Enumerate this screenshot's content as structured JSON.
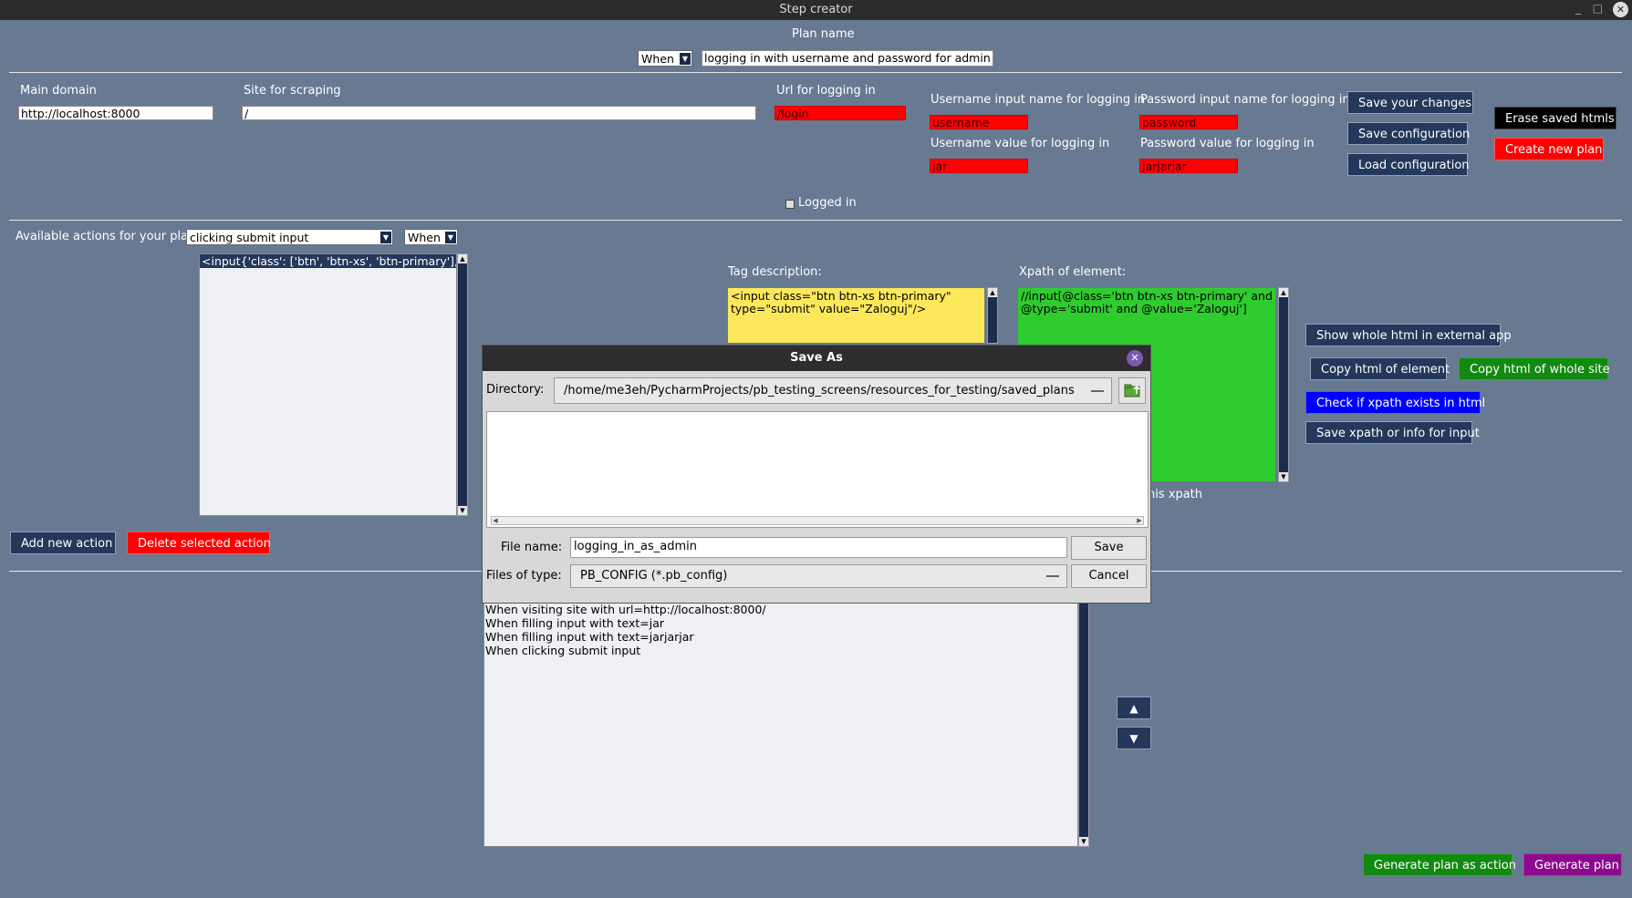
{
  "window": {
    "title": "Step creator",
    "minimize": "_",
    "maximize": "□",
    "close": "✕"
  },
  "plan": {
    "label": "Plan name",
    "when": "When",
    "name_value": "logging in with username and password for admin"
  },
  "config": {
    "main_domain_label": "Main domain",
    "main_domain_value": "http://localhost:8000",
    "site_label": "Site for scraping",
    "site_value": "/",
    "url_login_label": "Url for logging in",
    "url_login_value": "/login",
    "username_input_label": "Username input name for logging in",
    "username_input_value": "username",
    "username_value_label": "Username value for logging in",
    "username_value_value": "jar",
    "password_input_label": "Password input name for logging in",
    "password_input_value": "password",
    "password_value_label": "Password value for logging in",
    "password_value_value": "jarjarjar",
    "logged_in_label": "Logged in",
    "save_changes": "Save your changes",
    "save_config": "Save configuration",
    "load_config": "Load configuration",
    "erase_htmls": "Erase saved htmls",
    "create_plan": "Create new plan"
  },
  "actions": {
    "available_label": "Available actions for your plan",
    "selected_action": "clicking submit input",
    "when": "When",
    "list_items": [
      "<input{'class': ['btn', 'btn-xs', 'btn-primary'], 'type"
    ],
    "add_action": "Add new action",
    "delete_action": "Delete selected action"
  },
  "element": {
    "tag_label": "Tag description:",
    "tag_value": "<input class=\"btn btn-xs btn-primary\" type=\"submit\" value=\"Zaloguj\"/>",
    "xpath_label": "Xpath of element:",
    "xpath_value": "//input[@class='btn btn-xs btn-primary' and @type='submit' and @value='Zaloguj']",
    "partial_label": "his xpath",
    "show_html": "Show whole html in external app",
    "copy_element": "Copy html of element",
    "copy_site": "Copy html of whole site",
    "check_xpath": "Check if xpath exists in html",
    "save_xpath": "Save xpath or info for input"
  },
  "steps": {
    "items": [
      "When visiting site with url=http://localhost:8000/",
      "When filling input with text=jar",
      "When filling input with text=jarjarjar",
      "When clicking submit input"
    ],
    "up": "▲",
    "down": "▼",
    "generate_action": "Generate plan as action",
    "generate_plan": "Generate plan"
  },
  "dialog": {
    "title": "Save As",
    "close": "✕",
    "directory_label": "Directory:",
    "directory_value": "/home/me3eh/PycharmProjects/pb_testing_screens/resources_for_testing/saved_plans",
    "filename_label": "File name:",
    "filename_value": "logging_in_as_admin",
    "filetype_label": "Files of type:",
    "filetype_value": "PB_CONFIG (*.pb_config)",
    "save": "Save",
    "cancel": "Cancel"
  },
  "colors": {
    "background": "#687a92",
    "button": "#24385c",
    "red": "#ff0000",
    "yellow": "#fde85c",
    "green": "#2ecc2e"
  }
}
